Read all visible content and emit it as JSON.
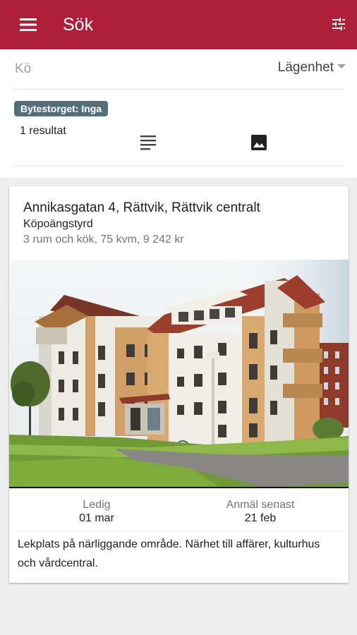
{
  "appbar": {
    "title": "Sök",
    "menu_icon": "menu-icon",
    "filter_icon": "tune-icon",
    "background": "#b01f3a"
  },
  "search": {
    "queue_label": "Kö",
    "type_value": "Lägenhet"
  },
  "summary": {
    "badge": "Bytestorget: Inga",
    "result_count": "1 resultat",
    "list_view_icon": "list-view-icon",
    "image_view_icon": "image-view-icon"
  },
  "listing": {
    "address": "Annikasgatan 4, Rättvik, Rättvik centralt",
    "contract": "Köpoängstyrd",
    "details": "3 rum och kök, 75 kvm, 9 242 kr",
    "available_label": "Ledig",
    "available_date": "01 mar",
    "apply_label": "Anmäl senast",
    "apply_date": "21 feb",
    "description": "Lekplats på närliggande område. Närhet till affärer, kulturhus och vårdcentral."
  }
}
